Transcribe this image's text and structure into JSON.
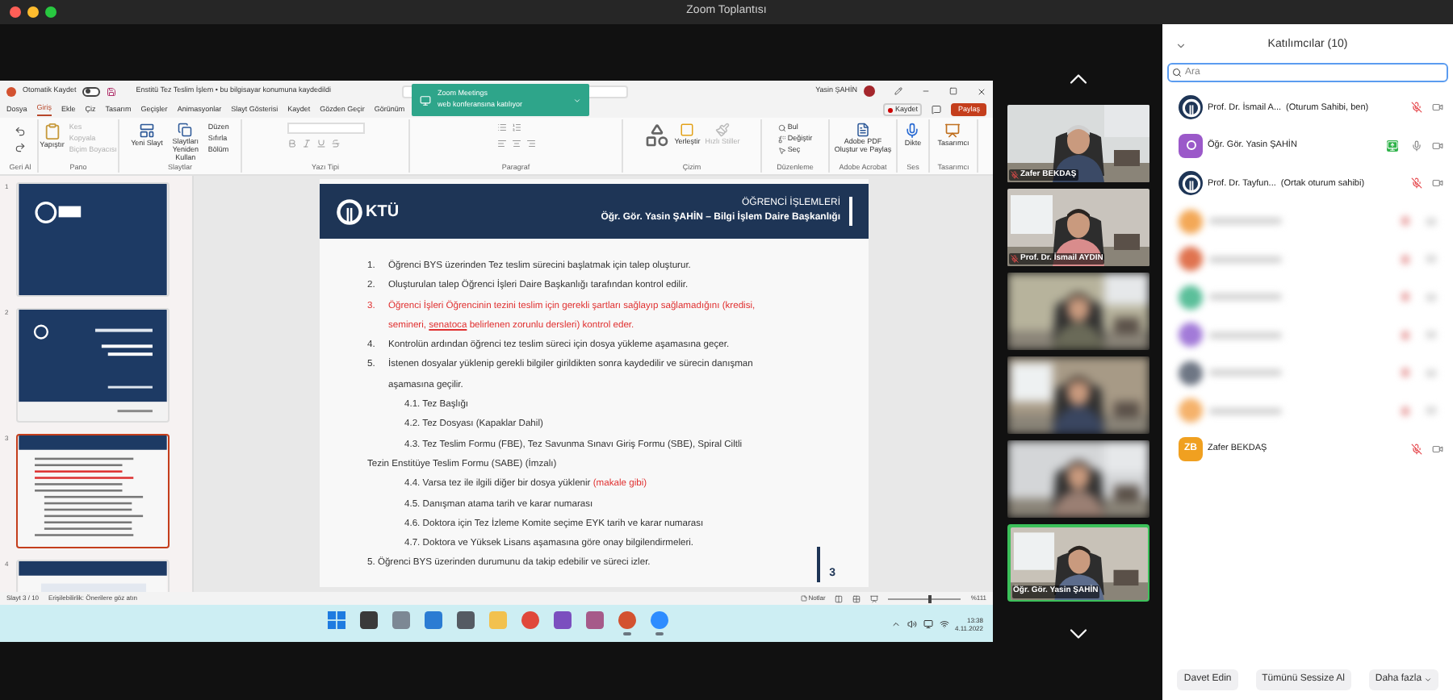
{
  "window": {
    "title": "Zoom Toplantısı"
  },
  "powerpoint": {
    "autosave": {
      "label": "Otomatik Kaydet",
      "on": false
    },
    "file_title": "Enstitü Tez Teslim İşlem • bu bilgisayar konumuna kaydedildi",
    "user": "Yasin ŞAHİN",
    "menu_tabs": [
      {
        "label": "Dosya",
        "selected": false
      },
      {
        "label": "Giriş",
        "selected": true
      },
      {
        "label": "Ekle",
        "selected": false
      },
      {
        "label": "Çiz",
        "selected": false
      },
      {
        "label": "Tasarım",
        "selected": false
      },
      {
        "label": "Geçişler",
        "selected": false
      },
      {
        "label": "Animasyonlar",
        "selected": false
      },
      {
        "label": "Slayt Gösterisi",
        "selected": false
      },
      {
        "label": "Kaydet",
        "selected": false
      },
      {
        "label": "Gözden Geçir",
        "selected": false
      },
      {
        "label": "Görünüm",
        "selected": false
      }
    ],
    "record_button": "Kaydet",
    "share_button": "Paylaş",
    "ribbon_groups": [
      {
        "kind": "undo",
        "label": "Geri Al"
      },
      {
        "kind": "clipboard",
        "label": "Pano",
        "buttons": [
          {
            "label": "Yapıştır",
            "disabled": false
          },
          {
            "label": "Kes",
            "disabled": true
          },
          {
            "label": "Kopyala",
            "disabled": true
          },
          {
            "label": "Biçim Boyacısı",
            "disabled": true
          }
        ]
      },
      {
        "kind": "slides",
        "label": "Slaytlar",
        "buttons": [
          {
            "label": "Yeni Slayt",
            "disabled": false
          },
          {
            "label": "Slaytları Yeniden Kullan",
            "disabled": false
          },
          {
            "label": "Düzen",
            "disabled": false
          },
          {
            "label": "Sıfırla",
            "disabled": false
          },
          {
            "label": "Bölüm",
            "disabled": false
          }
        ]
      },
      {
        "kind": "font",
        "label": "Yazı Tipi"
      },
      {
        "kind": "paragraph",
        "label": "Paragraf"
      },
      {
        "kind": "drawing",
        "label": "Çizim",
        "buttons": [
          {
            "label": "Yerleştir",
            "disabled": false
          },
          {
            "label": "Hızlı Stiller",
            "disabled": true
          }
        ]
      },
      {
        "kind": "editing",
        "label": "Düzenleme",
        "buttons": [
          {
            "label": "Bul",
            "disabled": false
          },
          {
            "label": "Değiştir",
            "disabled": false
          },
          {
            "label": "Seç",
            "disabled": false
          }
        ]
      },
      {
        "kind": "acrobat",
        "label": "Adobe Acrobat",
        "buttons": [
          {
            "label": "Adobe PDF Oluştur ve Paylaş",
            "disabled": false
          }
        ]
      },
      {
        "kind": "voice",
        "label": "Ses",
        "buttons": [
          {
            "label": "Dikte",
            "disabled": false
          }
        ]
      },
      {
        "kind": "designer",
        "label": "Tasarımcı",
        "buttons": [
          {
            "label": "Tasarımcı",
            "disabled": false
          }
        ]
      }
    ],
    "notification": {
      "title": "Zoom Meetings",
      "text": "web konferansına katılıyor"
    },
    "thumbnails": [
      {
        "number": "1",
        "kind": "cover",
        "selected": false
      },
      {
        "number": "2",
        "kind": "title",
        "selected": false
      },
      {
        "number": "3",
        "kind": "content",
        "selected": true
      },
      {
        "number": "4",
        "kind": "table",
        "selected": false
      }
    ],
    "slide": {
      "logo": "KTÜ",
      "title": "ÖĞRENCİ İŞLEMLERİ",
      "subtitle": "Öğr. Gör. Yasin ŞAHİN – Bilgi İşlem Daire Başkanlığı",
      "page_number": "3",
      "items": [
        {
          "number": "1.",
          "kind": "normal",
          "text": "Öğrenci BYS üzerinden Tez teslim sürecini başlatmak için talep oluşturur."
        },
        {
          "number": "2.",
          "kind": "normal",
          "text": "Oluşturulan talep Öğrenci İşleri Daire Başkanlığı tarafından kontrol edilir."
        },
        {
          "number": "3.",
          "kind": "alert",
          "text": "Öğrenci İşleri Öğrencinin tezini teslim için gerekli şartları sağlayıp sağlamadığını (kredisi, semineri,",
          "underlined": "senatoca",
          "text_after": "belirlenen zorunlu dersleri) kontrol eder."
        },
        {
          "number": "4.",
          "kind": "normal",
          "text": "Kontrolün ardından öğrenci tez teslim süreci için dosya yükleme aşamasına geçer."
        },
        {
          "number": "5.",
          "kind": "normal",
          "text": "İstenen dosyalar yüklenip gerekli bilgiler girildikten sonra kaydedilir ve sürecin danışman aşamasına geçilir.",
          "children": [
            {
              "text": "4.1. Tez Başlığı"
            },
            {
              "text": "4.2. Tez Dosyası (Kapaklar Dahil)"
            },
            {
              "text": "4.3. Tez Teslim Formu (FBE), Tez Savunma Sınavı Giriş Formu (SBE), Spiral Ciltli",
              "continuation": "Tezin Enstitüye Teslim Formu (SABE) (İmzalı)"
            },
            {
              "text": "4.4. Varsa tez ile ilgili diğer bir dosya yüklenir",
              "note": "(makale gibi)"
            },
            {
              "text": "4.5. Danışman atama tarih ve karar numarası"
            },
            {
              "text": "4.6. Doktora için Tez İzleme Komite seçime EYK tarih ve karar numarası"
            },
            {
              "text": "4.7. Doktora ve Yüksek Lisans aşamasına göre onay bilgilendirmeleri."
            }
          ]
        },
        {
          "kind": "plain",
          "text": "5. Öğrenci BYS üzerinden durumunu da takip edebilir ve süreci izler."
        }
      ]
    },
    "status_bar": {
      "slide": "Slayt 3 / 10",
      "accessibility": "Erişilebilirlik: Önerilere göz atın",
      "notes": "Notlar",
      "zoom": {
        "level": 0.55
      },
      "zoom_reading": "%111"
    },
    "taskbar": {
      "apps": [
        {
          "kind": "start",
          "running": false
        },
        {
          "kind": "explorer",
          "running": false
        },
        {
          "kind": "widgets",
          "running": false
        },
        {
          "kind": "mail",
          "running": false
        },
        {
          "kind": "snip",
          "running": false
        },
        {
          "kind": "folder",
          "running": false
        },
        {
          "kind": "chrome",
          "running": false
        },
        {
          "kind": "visualstudio",
          "running": false
        },
        {
          "kind": "archive",
          "running": false
        },
        {
          "kind": "powerpoint",
          "running": true
        },
        {
          "kind": "zoom",
          "running": true
        }
      ],
      "time": "13:38",
      "date": "4.11.2022"
    }
  },
  "video_tiles": [
    {
      "name": "Zafer BEKDAŞ",
      "muted": true,
      "blurred": false,
      "speaking": false
    },
    {
      "name": "Prof. Dr. İsmail AYDIN",
      "muted": true,
      "blurred": false,
      "speaking": false
    },
    {
      "blurred": true,
      "speaking": false
    },
    {
      "blurred": true,
      "speaking": false
    },
    {
      "blurred": true,
      "speaking": false
    },
    {
      "name": "Öğr. Gör. Yasin ŞAHİN",
      "muted": false,
      "blurred": false,
      "speaking": true
    }
  ],
  "participants_panel": {
    "title": "Katılımcılar (10)",
    "search": {
      "placeholder": "Ara"
    },
    "participants": [
      {
        "kind": "logo",
        "name": "Prof. Dr. İsmail A...",
        "role": "(Oturum Sahibi, ben)",
        "muted": true
      },
      {
        "kind": "icon",
        "name": "Öğr. Gör. Yasin ŞAHİN",
        "muted": false,
        "sharing": true
      },
      {
        "kind": "logo",
        "name": "Prof. Dr. Tayfun...",
        "role": "(Ortak oturum sahibi)",
        "muted": true
      },
      {
        "kind": "blurred",
        "color": "#f3a857"
      },
      {
        "kind": "blurred",
        "color": "#e0734f"
      },
      {
        "kind": "blurred",
        "color": "#5bbf9a"
      },
      {
        "kind": "blurred",
        "color": "#a27ad8"
      },
      {
        "kind": "blurred",
        "color": "#6e7684"
      },
      {
        "kind": "blurred",
        "color": "#f5b26b"
      },
      {
        "kind": "initials",
        "initials": "ZB",
        "name": "Zafer BEKDAŞ",
        "muted": true
      }
    ],
    "buttons": [
      "Davet Edin",
      "Tümünü Sessize Al"
    ],
    "more_button": "Daha fazla"
  }
}
